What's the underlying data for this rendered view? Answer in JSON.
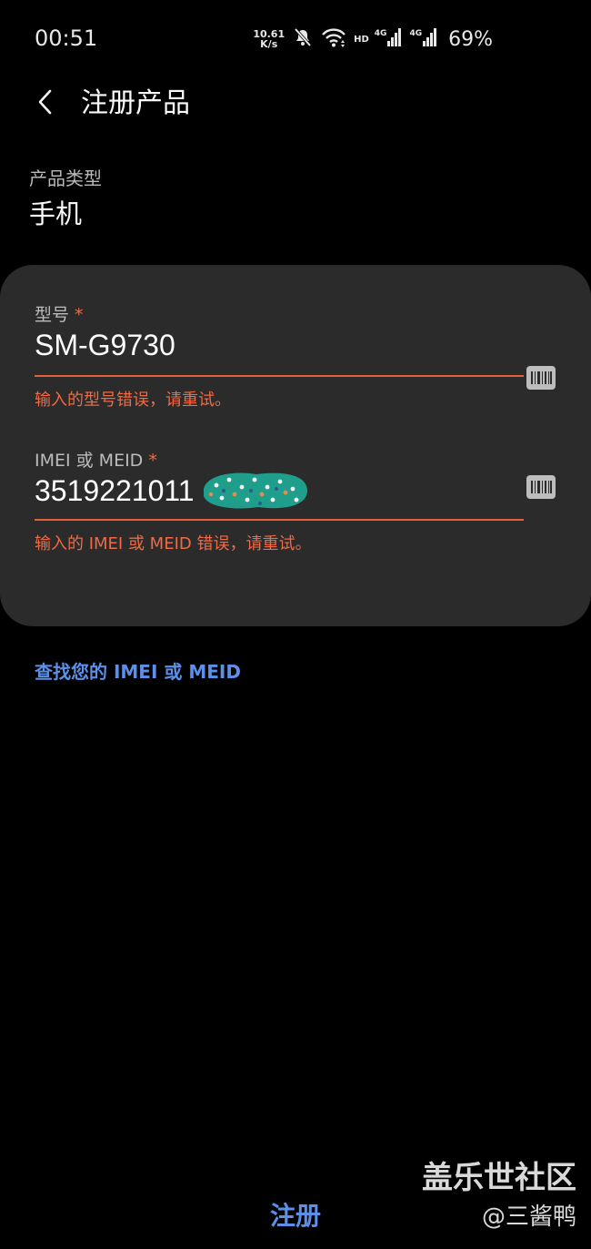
{
  "status_bar": {
    "time": "00:51",
    "net_speed_value": "10.61",
    "net_speed_unit": "K/s",
    "hd_label": "HD",
    "sim1_label": "4G",
    "sim2_label": "4G",
    "battery": "69%"
  },
  "header": {
    "title": "注册产品"
  },
  "product_type": {
    "label": "产品类型",
    "value": "手机"
  },
  "model_field": {
    "label": "型号",
    "required_mark": "*",
    "value": "SM-G9730",
    "error": "输入的型号错误，请重试。"
  },
  "imei_field": {
    "label": "IMEI 或 MEID",
    "required_mark": "*",
    "value": "3519221011",
    "error": "输入的 IMEI 或 MEID 错误，请重试。"
  },
  "find_imei_link": "查找您的 IMEI 或 MEID",
  "register_button": "注册",
  "watermark": {
    "title": "盖乐世社区",
    "user": "@三酱鸭"
  },
  "colors": {
    "background": "#000000",
    "card": "#2b2b2b",
    "error": "#ef6a45",
    "link": "#5b8fe8"
  },
  "icons": [
    "mute-icon",
    "wifi-icon",
    "signal-icon",
    "back-icon",
    "barcode-scan-icon"
  ]
}
